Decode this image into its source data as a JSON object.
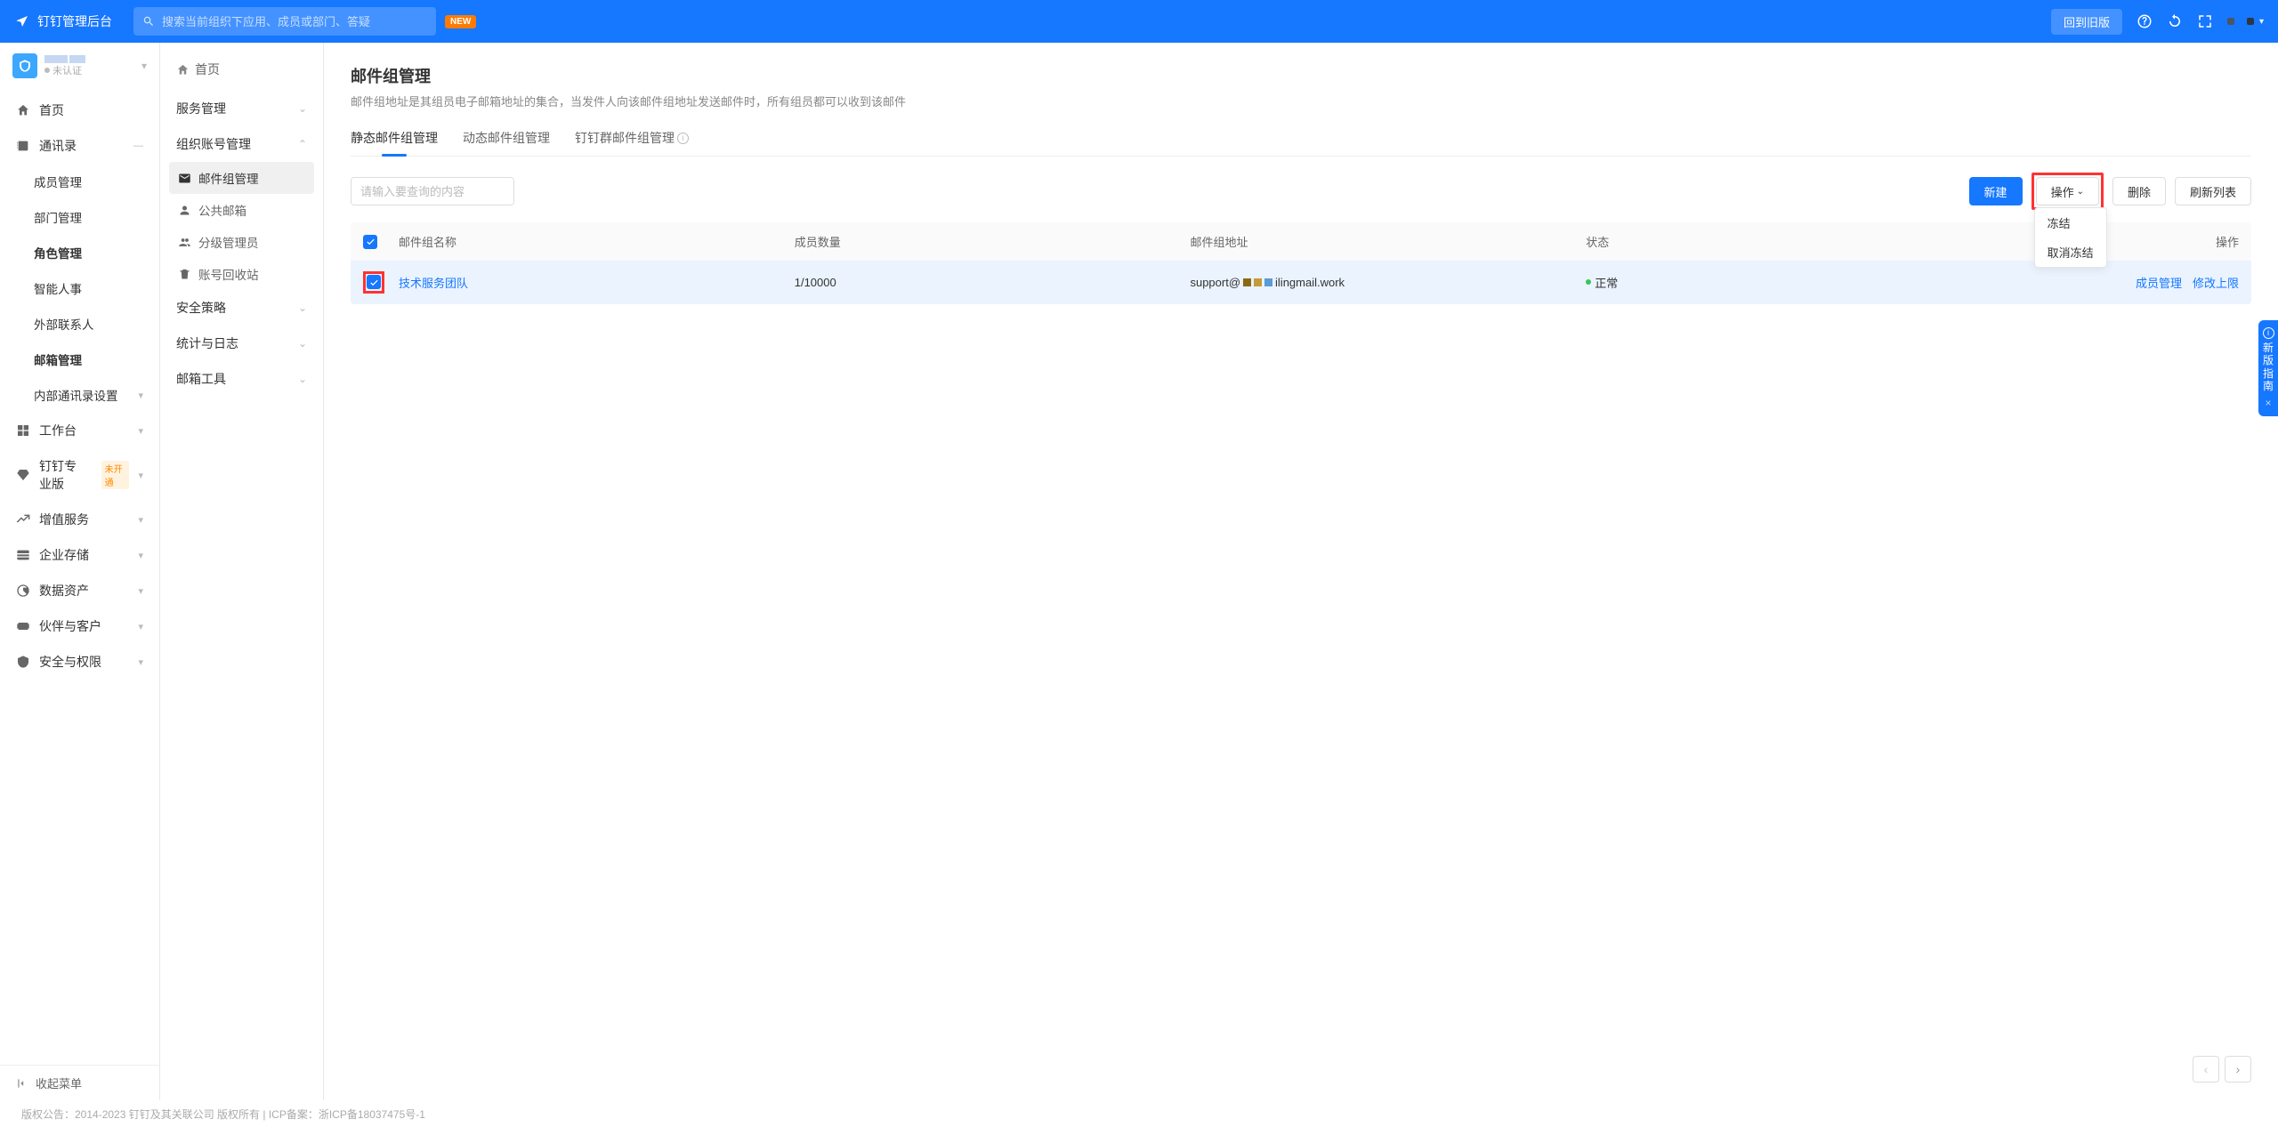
{
  "header": {
    "title": "钉钉管理后台",
    "search_placeholder": "搜索当前组织下应用、成员或部门、答疑",
    "new_badge": "NEW",
    "old_version_btn": "回到旧版"
  },
  "org": {
    "not_verified": "未认证"
  },
  "sidebar": {
    "items": [
      {
        "label": "首页",
        "icon": "home"
      },
      {
        "label": "通讯录",
        "icon": "contacts",
        "expanded": true,
        "children": [
          {
            "label": "成员管理"
          },
          {
            "label": "部门管理"
          },
          {
            "label": "角色管理",
            "bold": true
          },
          {
            "label": "智能人事"
          },
          {
            "label": "外部联系人"
          },
          {
            "label": "邮箱管理",
            "bold": true
          },
          {
            "label": "内部通讯录设置",
            "chev": true
          }
        ]
      },
      {
        "label": "工作台",
        "icon": "grid",
        "chev": true
      },
      {
        "label": "钉钉专业版",
        "icon": "diamond",
        "tag": "未开通",
        "chev": true
      },
      {
        "label": "增值服务",
        "icon": "trend",
        "chev": true
      },
      {
        "label": "企业存储",
        "icon": "storage",
        "chev": true
      },
      {
        "label": "数据资产",
        "icon": "data",
        "chev": true
      },
      {
        "label": "伙伴与客户",
        "icon": "partner",
        "chev": true
      },
      {
        "label": "安全与权限",
        "icon": "shield",
        "chev": true
      }
    ],
    "collapse": "收起菜单"
  },
  "subbar": {
    "home": "首页",
    "groups": [
      {
        "title": "服务管理",
        "collapsed": true
      },
      {
        "title": "组织账号管理",
        "expanded": true,
        "items": [
          {
            "label": "邮件组管理",
            "icon": "mailgroup",
            "active": true
          },
          {
            "label": "公共邮箱",
            "icon": "public"
          },
          {
            "label": "分级管理员",
            "icon": "admin"
          },
          {
            "label": "账号回收站",
            "icon": "trash"
          }
        ]
      },
      {
        "title": "安全策略",
        "collapsed": true
      },
      {
        "title": "统计与日志",
        "collapsed": true
      },
      {
        "title": "邮箱工具",
        "collapsed": true
      }
    ]
  },
  "page": {
    "title": "邮件组管理",
    "desc": "邮件组地址是其组员电子邮箱地址的集合，当发件人向该邮件组地址发送邮件时，所有组员都可以收到该邮件",
    "tabs": [
      {
        "label": "静态邮件组管理",
        "active": true
      },
      {
        "label": "动态邮件组管理"
      },
      {
        "label": "钉钉群邮件组管理",
        "info": true
      }
    ],
    "search_placeholder": "请输入要查询的内容",
    "buttons": {
      "new": "新建",
      "operate": "操作",
      "delete": "删除",
      "refresh": "刷新列表"
    },
    "dropdown": {
      "freeze": "冻结",
      "unfreeze": "取消冻结"
    },
    "columns": {
      "name": "邮件组名称",
      "count": "成员数量",
      "addr": "邮件组地址",
      "status": "状态",
      "op": "操作"
    },
    "rows": [
      {
        "name": "技术服务团队",
        "count": "1/10000",
        "addr_prefix": "support@",
        "addr_suffix": "ilingmail.work",
        "status": "正常",
        "ops": [
          "成员管理",
          "修改上限"
        ]
      }
    ]
  },
  "guide": {
    "text": "新版指南",
    "close": "×"
  },
  "footer": {
    "text": "版权公告：2014-2023 钉钉及其关联公司 版权所有 | ICP备案：浙ICP备18037475号-1"
  }
}
